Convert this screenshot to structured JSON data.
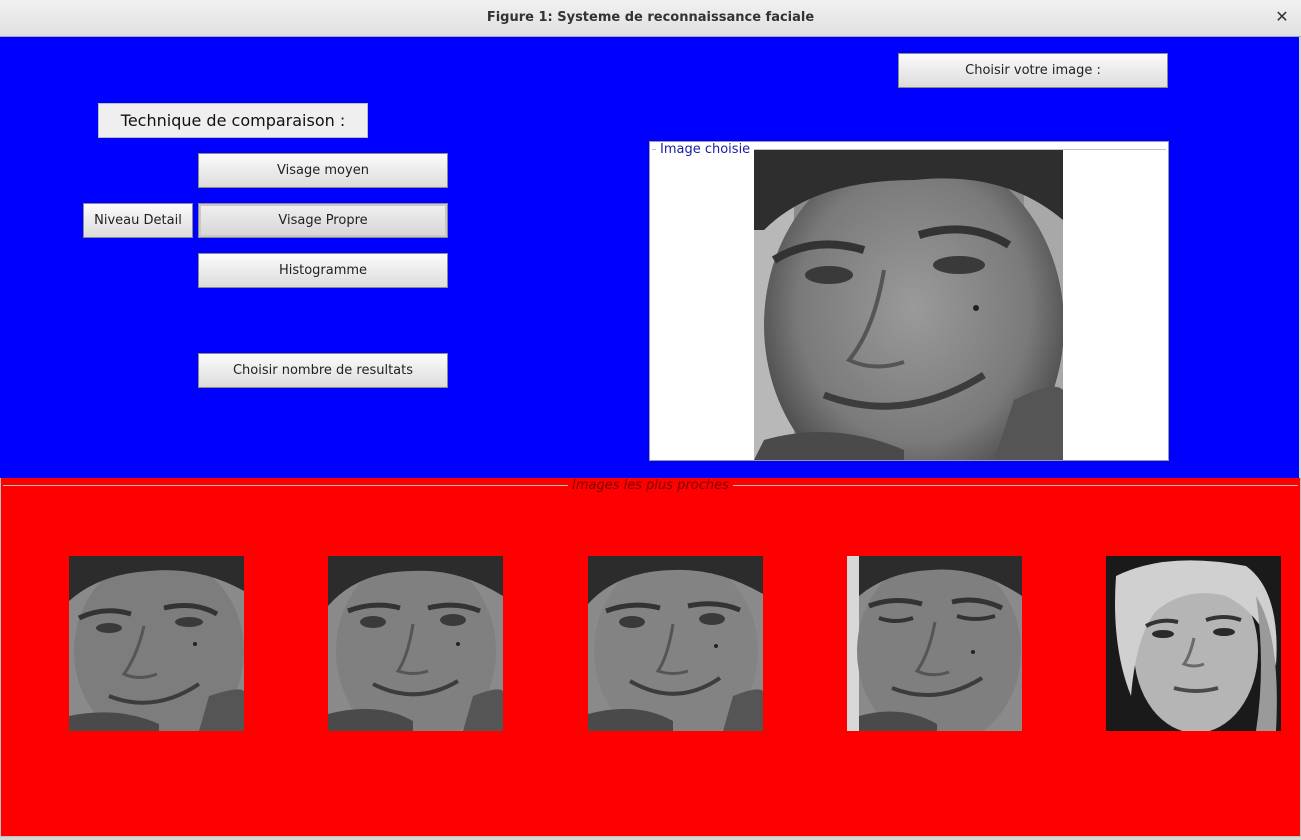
{
  "window": {
    "title": "Figure 1: Systeme de reconnaissance faciale",
    "close_glyph": "✕"
  },
  "top_panel": {
    "background": "#0000ff",
    "technique_label": "Technique de comparaison :",
    "buttons": {
      "visage_moyen": "Visage moyen",
      "visage_propre": "Visage Propre",
      "histogramme": "Histogramme",
      "niveau_detail": "Niveau Detail",
      "choisir_nombre": "Choisir nombre de resultats",
      "choisir_image": "Choisir votre image :"
    },
    "image_panel": {
      "legend": "Image choisie",
      "image": "grayscale-face-photo"
    }
  },
  "bottom_panel": {
    "background": "#ff0000",
    "legend": "Images les plus proches",
    "results": [
      {
        "image": "grayscale-face-photo-male",
        "expression": "smile-squint"
      },
      {
        "image": "grayscale-face-photo-male",
        "expression": "smile"
      },
      {
        "image": "grayscale-face-photo-male",
        "expression": "smile"
      },
      {
        "image": "grayscale-face-photo-male",
        "expression": "wink"
      },
      {
        "image": "grayscale-face-photo-female",
        "expression": "neutral"
      }
    ]
  }
}
